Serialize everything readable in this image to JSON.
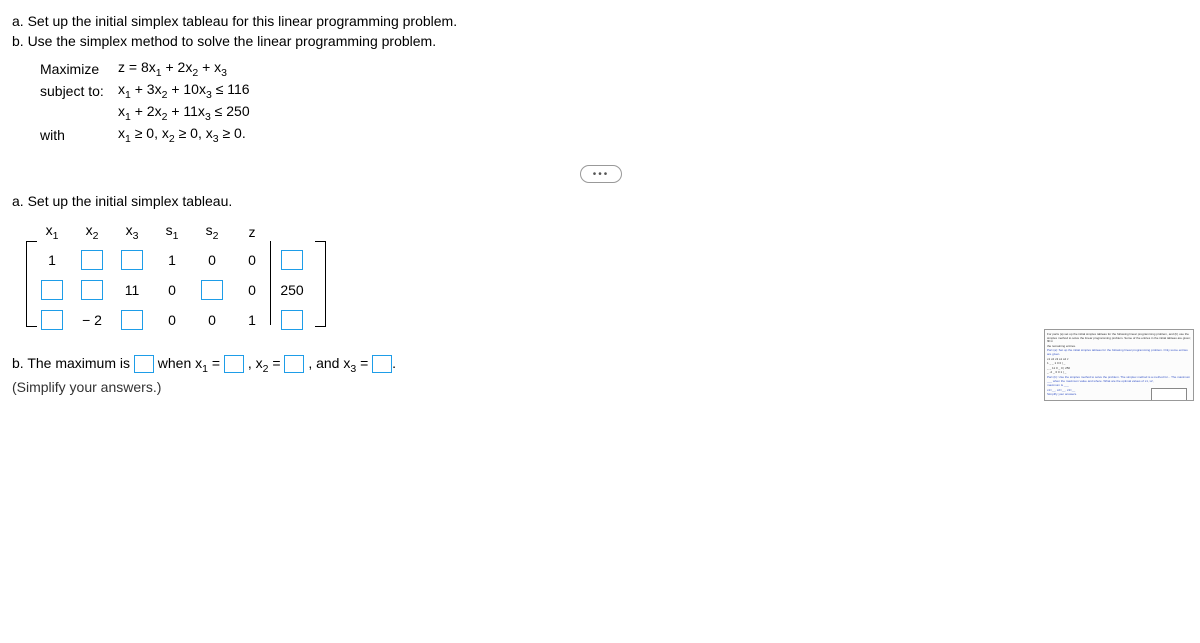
{
  "intro": {
    "a": "a. Set up the initial simplex tableau for this linear programming problem.",
    "b": "b. Use the simplex method to solve the linear programming problem."
  },
  "lp": {
    "maximize_lbl": "Maximize",
    "objective_pre": "z = 8x",
    "objective_mid1": " + 2x",
    "objective_mid2": " + x",
    "subject_lbl": "subject to:",
    "c1_a": "x",
    "c1_b": " + 3x",
    "c1_c": " + 10x",
    "c1_d": " ≤ 116",
    "c2_a": "x",
    "c2_b": " + 2x",
    "c2_c": " + 11x",
    "c2_d": " ≤ 250",
    "with_lbl": "with",
    "nn_a": "x",
    "nn_b": " ≥ 0, x",
    "nn_c": " ≥ 0, x",
    "nn_d": " ≥ 0."
  },
  "ellipsis": "•••",
  "sectA": {
    "heading": "a. Set up the initial simplex tableau.",
    "headers": {
      "x1": "x",
      "x2": "x",
      "x3": "x",
      "s1": "s",
      "s2": "s",
      "z": "z"
    },
    "subs": {
      "1": "1",
      "2": "2",
      "3": "3"
    },
    "cells": {
      "r1c1": "1",
      "r1c4": "1",
      "r1c5": "0",
      "r1c6": "0",
      "r2c3": "11",
      "r2c4": "0",
      "r2c6": "0",
      "r2rhs": "250",
      "r3c2": "− 2",
      "r3c4": "0",
      "r3c5": "0",
      "r3c6": "1"
    }
  },
  "sectB": {
    "pre": "b. The maximum is ",
    "mid1": " when x",
    "eq": " = ",
    "mid2": ", x",
    "mid3": ", and x",
    "end": ".",
    "simplify": "(Simplify your answers.)"
  },
  "thumb": {
    "l1": "For parts (a) set up the initial simplex tableau for the following linear programming problem, and (b) use the simplex method to solve the linear programming problem. Some of the entries in the initial tableau are given; fill in",
    "l2": "the remaining entries.",
    "l3": "Part (a): Set up the initial simplex tableau for the following linear programming problem. Only some entries are given.",
    "l4": "x1 x2 x3 s1 s2 z",
    "l5": "1  _  _  1  0  0 | _",
    "l6": "_  _ 11  0  _  0 | 250",
    "l7": "_ -2  _  0  0  1 | _",
    "l8": "Part (b): Use the simplex method to solve the problem. The simplex method is a method for... The maximum ___ when the maximum value and where. What are the optimal values of x1, x2,",
    "l9": "maximum is ___",
    "l10": "x1=__, x2=__, x3=__",
    "l11": "Simplify your answers."
  }
}
